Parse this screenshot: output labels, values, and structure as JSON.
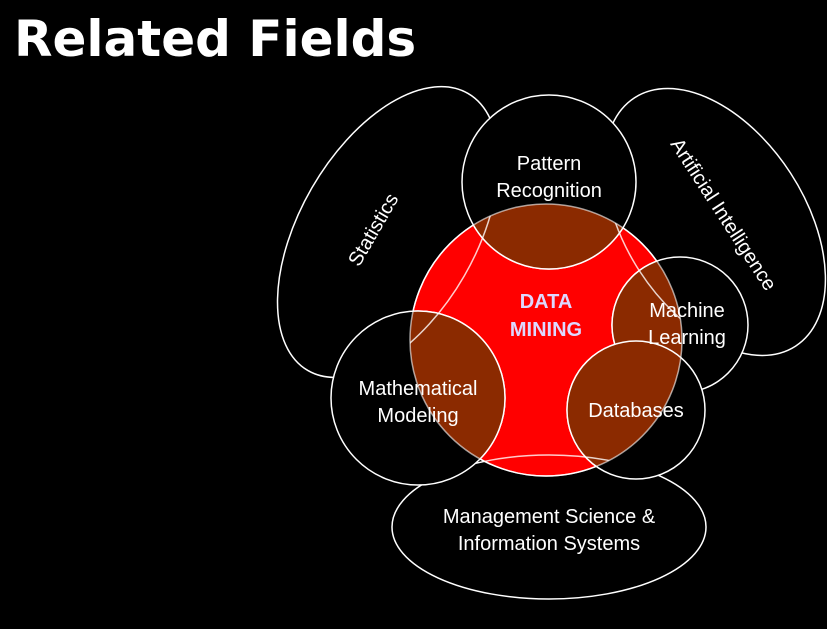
{
  "title": "Related Fields",
  "colors": {
    "background": "#000000",
    "core_fill": "#ff0000",
    "overlap_fill": "#8b2a00",
    "outline": "#ffffff",
    "core_text": "#ddd8ff"
  },
  "center": {
    "line1": "DATA",
    "line2": "MINING"
  },
  "fields": {
    "statistics": "Statistics",
    "artificial_intelligence": "Artificial Intelligence",
    "pattern_recognition": {
      "line1": "Pattern",
      "line2": "Recognition"
    },
    "machine_learning": {
      "line1": "Machine",
      "line2": "Learning"
    },
    "databases": "Databases",
    "mathematical_modeling": {
      "line1": "Mathematical",
      "line2": "Modeling"
    },
    "management_science": {
      "line1": "Management Science &",
      "line2": "Information Systems"
    }
  }
}
